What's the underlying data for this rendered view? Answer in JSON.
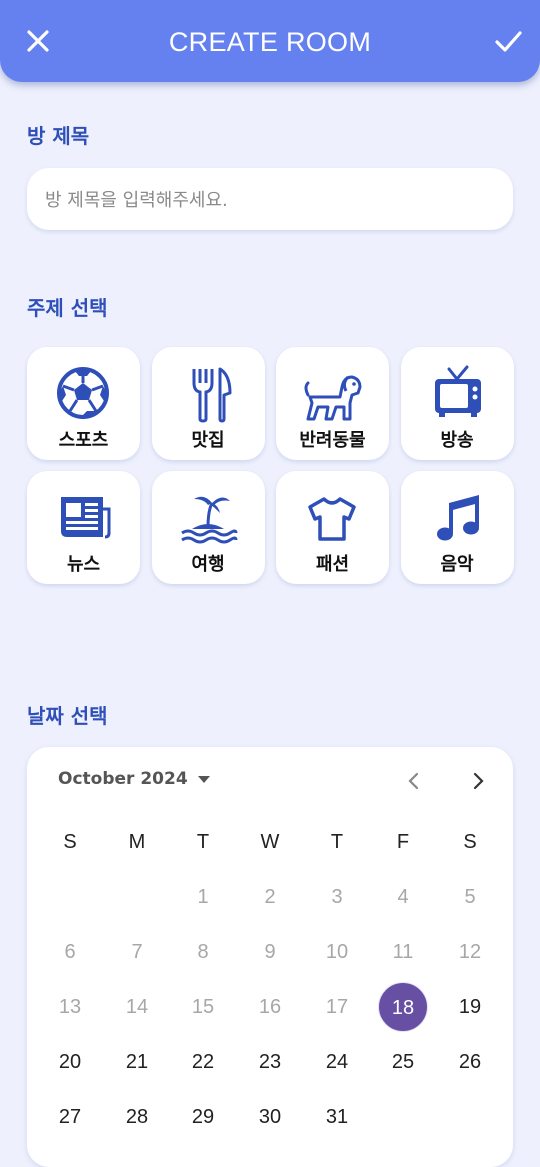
{
  "app_bar": {
    "title": "CREATE ROOM",
    "close_icon": "close-icon",
    "confirm_icon": "check-icon",
    "background": "#6581ef"
  },
  "room_title": {
    "label": "방 제목",
    "placeholder": "방 제목을 입력해주세요.",
    "value": ""
  },
  "topic": {
    "label": "주제 선택",
    "items": [
      {
        "label": "스포츠",
        "icon": "soccer-ball-icon"
      },
      {
        "label": "맛집",
        "icon": "fork-knife-icon"
      },
      {
        "label": "반려동물",
        "icon": "dog-icon"
      },
      {
        "label": "방송",
        "icon": "tv-icon"
      },
      {
        "label": "뉴스",
        "icon": "newspaper-icon"
      },
      {
        "label": "여행",
        "icon": "island-icon"
      },
      {
        "label": "패션",
        "icon": "shirt-icon"
      },
      {
        "label": "음악",
        "icon": "music-note-icon"
      }
    ],
    "icon_color": "#2f4fb8"
  },
  "date": {
    "label": "날짜 선택",
    "month_label": "October 2024",
    "weekdays": [
      "S",
      "M",
      "T",
      "W",
      "T",
      "F",
      "S"
    ],
    "weeks": [
      [
        "",
        "",
        "1",
        "2",
        "3",
        "4",
        "5"
      ],
      [
        "6",
        "7",
        "8",
        "9",
        "10",
        "11",
        "12"
      ],
      [
        "13",
        "14",
        "15",
        "16",
        "17",
        "18",
        "19"
      ],
      [
        "20",
        "21",
        "22",
        "23",
        "24",
        "25",
        "26"
      ],
      [
        "27",
        "28",
        "29",
        "30",
        "31",
        "",
        ""
      ]
    ],
    "selected": "18",
    "first_enabled": "18",
    "selected_color": "#6750a4"
  }
}
